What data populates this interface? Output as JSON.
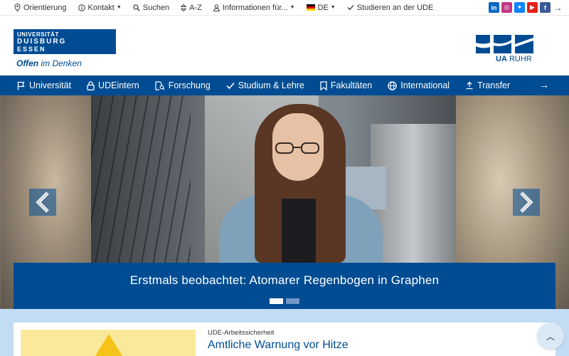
{
  "topbar": {
    "items": [
      {
        "label": "Orientierung",
        "icon": "pin-icon"
      },
      {
        "label": "Kontakt",
        "icon": "info-icon",
        "dropdown": true
      },
      {
        "label": "Suchen",
        "icon": "search-icon"
      },
      {
        "label": "A-Z",
        "icon": "sort-icon"
      },
      {
        "label": "Informationen für...",
        "icon": "user-icon",
        "dropdown": true
      },
      {
        "label": "DE",
        "icon": "flag-de-icon",
        "dropdown": true
      },
      {
        "label": "Studieren an der UDE",
        "icon": "check-icon"
      }
    ],
    "social": [
      {
        "name": "linkedin-icon",
        "glyph": "in",
        "color": "#0a66c2"
      },
      {
        "name": "instagram-icon",
        "glyph": "◎",
        "color": "#c13584"
      },
      {
        "name": "bluesky-icon",
        "glyph": "✦",
        "color": "#1185fe"
      },
      {
        "name": "youtube-icon",
        "glyph": "▶",
        "color": "#e62117"
      },
      {
        "name": "facebook-icon",
        "glyph": "f",
        "color": "#3b5998"
      }
    ]
  },
  "header": {
    "logo": {
      "line1": "UNIVERSITÄT",
      "line2": "DUISBURG",
      "line3": "ESSEN"
    },
    "tagline_bold": "Offen",
    "tagline_rest": " im Denken",
    "partner": {
      "ua": "UA",
      "ruhr": "RUHR"
    }
  },
  "nav": {
    "items": [
      {
        "label": "Universität",
        "icon": "flag-icon"
      },
      {
        "label": "UDEintern",
        "icon": "lock-icon"
      },
      {
        "label": "Forschung",
        "icon": "search-doc-icon"
      },
      {
        "label": "Studium & Lehre",
        "icon": "check-icon"
      },
      {
        "label": "Fakultäten",
        "icon": "bookmark-icon"
      },
      {
        "label": "International",
        "icon": "globe-icon"
      },
      {
        "label": "Transfer",
        "icon": "upload-icon"
      }
    ]
  },
  "hero": {
    "caption": "Erstmals beobachtet: Atomarer Regenbogen in Graphen",
    "slides": 2,
    "active_slide": 0
  },
  "teaser": {
    "kicker": "UDE-Arbeitssicherheit",
    "title": "Amtliche Warnung vor Hitze"
  },
  "colors": {
    "brand": "#004c93",
    "light_bg": "#c2dcf4"
  }
}
